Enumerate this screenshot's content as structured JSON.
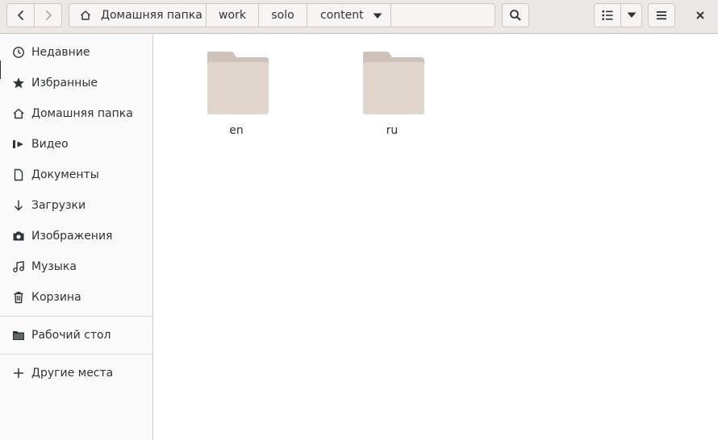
{
  "toolbar": {
    "path": [
      "Домашняя папка",
      "work",
      "solo",
      "content"
    ]
  },
  "sidebar": {
    "items": [
      {
        "label": "Недавние",
        "icon": "clock-icon"
      },
      {
        "label": "Избранные",
        "icon": "star-icon"
      },
      {
        "label": "Домашняя папка",
        "icon": "home-icon"
      },
      {
        "label": "Видео",
        "icon": "video-icon"
      },
      {
        "label": "Документы",
        "icon": "document-icon"
      },
      {
        "label": "Загрузки",
        "icon": "download-icon"
      },
      {
        "label": "Изображения",
        "icon": "camera-icon"
      },
      {
        "label": "Музыка",
        "icon": "music-icon"
      },
      {
        "label": "Корзина",
        "icon": "trash-icon"
      }
    ],
    "bookmarks": [
      {
        "label": "Рабочий стол",
        "icon": "folder-icon"
      }
    ],
    "other": {
      "label": "Другие места",
      "icon": "plus-icon"
    }
  },
  "main": {
    "folders": [
      {
        "name": "en"
      },
      {
        "name": "ru"
      }
    ]
  },
  "colors": {
    "headerbar": "#ebe8e6",
    "folder": "#e0d6cd",
    "folder_tab": "#cfc2b6"
  }
}
